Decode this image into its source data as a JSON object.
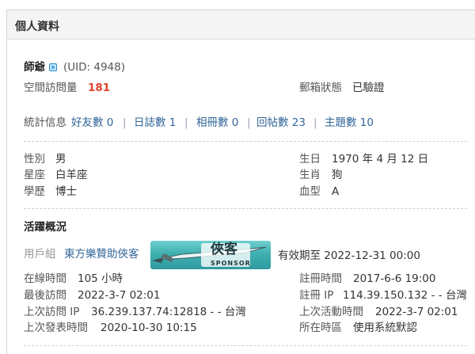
{
  "panel": {
    "title": "個人資料"
  },
  "user": {
    "name": "師爺",
    "uid": "(UID: 4948)",
    "visits_label": "空間訪問量",
    "visits_value": "181",
    "email_status_label": "郵箱狀態",
    "email_status_value": "已驗證"
  },
  "stats": {
    "label": "統計信息",
    "items": [
      {
        "label": "好友數 0"
      },
      {
        "label": "日誌數 1"
      },
      {
        "label": "相冊數 0"
      },
      {
        "label": "回帖數 23"
      },
      {
        "label": "主題數 10"
      }
    ],
    "separator": "|"
  },
  "profile": {
    "gender_label": "性別",
    "gender_value": "男",
    "zodiac_label": "星座",
    "zodiac_value": "白羊座",
    "education_label": "學歷",
    "education_value": "博士",
    "birthday_label": "生日",
    "birthday_value": "1970 年 4 月 12 日",
    "chinese_zodiac_label": "生肖",
    "chinese_zodiac_value": "狗",
    "blood_label": "血型",
    "blood_value": "A"
  },
  "activity": {
    "heading": "活躍概況",
    "group_label": "用戶組",
    "group_value": "東方樂贊助俠客",
    "badge_text": "俠客",
    "badge_subtext": "SPONSOR",
    "expiry": "有效期至 2022-12-31 00:00",
    "online_label": "在線時間",
    "online_value": "105 小時",
    "last_visit_label": "最後訪問",
    "last_visit_value": "2022-3-7 02:01",
    "last_ip_label": "上次訪問 IP",
    "last_ip_value": "36.239.137.74:12818 - - 台灣",
    "last_post_label": "上次發表時間",
    "last_post_value": "2020-10-30 10:15",
    "reg_time_label": "註冊時間",
    "reg_time_value": "2017-6-6 19:00",
    "reg_ip_label": "註冊 IP",
    "reg_ip_value": "114.39.150.132 - - 台灣",
    "last_active_label": "上次活動時間",
    "last_active_value": "2022-3-7 02:01",
    "timezone_label": "所在時區",
    "timezone_value": "使用系統默認"
  },
  "colors": {
    "link": "#336699",
    "visits": "#e0442e",
    "badge": "#3fb0b0"
  }
}
